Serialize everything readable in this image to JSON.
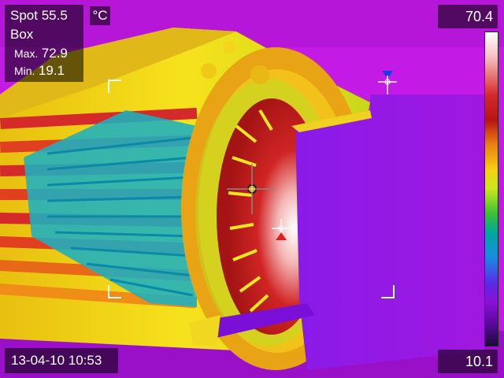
{
  "spot": {
    "label": "Spot",
    "value": "55.5"
  },
  "box": {
    "label": "Box",
    "max_label": "Max.",
    "max_value": "72.9",
    "min_label": "Min.",
    "min_value": "19.1"
  },
  "unit": "°C",
  "scale": {
    "max": "70.4",
    "min": "10.1"
  },
  "datetime": "13-04-10 10:53",
  "colors": {
    "hot": "#ffffff",
    "warm": "#d42a2a",
    "mid": "#f4d010",
    "cool": "#00a8a0",
    "cold": "#8a10d8",
    "background": "#c01ee8"
  }
}
